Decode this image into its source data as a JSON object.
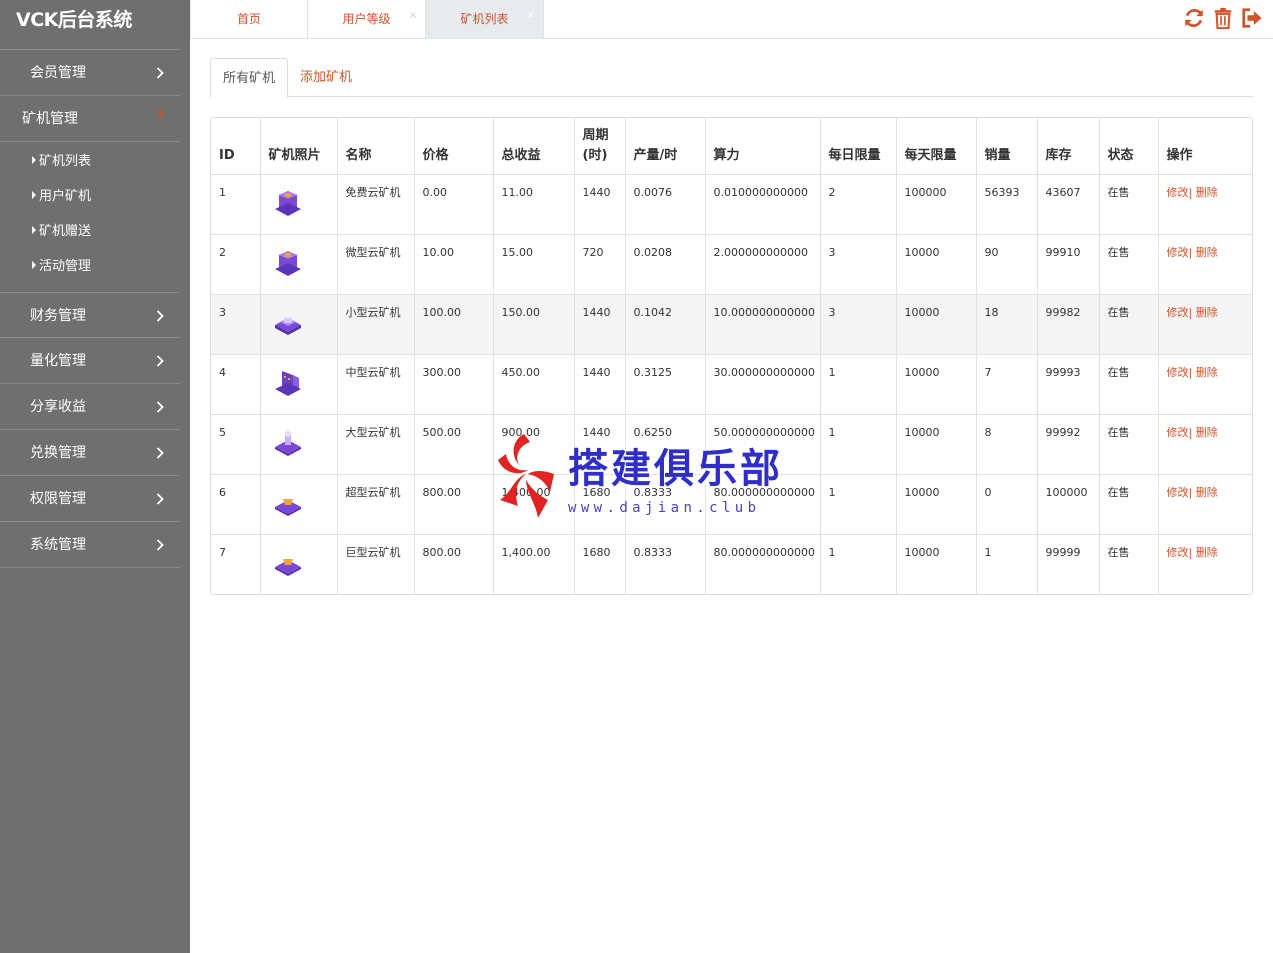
{
  "sidebar": {
    "brand": "VCK后台系统",
    "menu": [
      {
        "label": "会员管理"
      },
      {
        "label": "矿机管理",
        "open": true
      },
      {
        "label": "财务管理"
      },
      {
        "label": "量化管理"
      },
      {
        "label": "分享收益"
      },
      {
        "label": "兑换管理"
      },
      {
        "label": "权限管理"
      },
      {
        "label": "系统管理"
      }
    ],
    "submenu": [
      "矿机列表",
      "用户矿机",
      "矿机赠送",
      "活动管理"
    ]
  },
  "topbar": {
    "tabs": [
      {
        "label": "首页"
      },
      {
        "label": "用户等级"
      },
      {
        "label": "矿机列表",
        "active": true
      }
    ],
    "close_glyph": "×",
    "tools": [
      "refresh-icon",
      "trash-icon",
      "logout-icon"
    ]
  },
  "subtabs": [
    "所有矿机",
    "添加矿机"
  ],
  "table": {
    "headers": [
      "ID",
      "矿机照片",
      "名称",
      "价格",
      "总收益",
      "周期(时)",
      "产量/时",
      "算力",
      "每日限量",
      "每天限量",
      "销量",
      "库存",
      "状态",
      "操作"
    ],
    "header_period_line1": "周期",
    "header_period_line2": "(时)",
    "rows": [
      {
        "id": "1",
        "name": "免费云矿机",
        "price": "0.00",
        "total": "11.00",
        "period": "1440",
        "output": "0.0076",
        "power": "0.010000000000",
        "daily": "2",
        "perday": "100000",
        "sold": "56393",
        "stock": "43607",
        "status": "在售"
      },
      {
        "id": "2",
        "name": "微型云矿机",
        "price": "10.00",
        "total": "15.00",
        "period": "720",
        "output": "0.0208",
        "power": "2.000000000000",
        "daily": "3",
        "perday": "10000",
        "sold": "90",
        "stock": "99910",
        "status": "在售"
      },
      {
        "id": "3",
        "name": "小型云矿机",
        "price": "100.00",
        "total": "150.00",
        "period": "1440",
        "output": "0.1042",
        "power": "10.000000000000",
        "daily": "3",
        "perday": "10000",
        "sold": "18",
        "stock": "99982",
        "status": "在售"
      },
      {
        "id": "4",
        "name": "中型云矿机",
        "price": "300.00",
        "total": "450.00",
        "period": "1440",
        "output": "0.3125",
        "power": "30.000000000000",
        "daily": "1",
        "perday": "10000",
        "sold": "7",
        "stock": "99993",
        "status": "在售"
      },
      {
        "id": "5",
        "name": "大型云矿机",
        "price": "500.00",
        "total": "900.00",
        "period": "1440",
        "output": "0.6250",
        "power": "50.000000000000",
        "daily": "1",
        "perday": "10000",
        "sold": "8",
        "stock": "99992",
        "status": "在售"
      },
      {
        "id": "6",
        "name": "超型云矿机",
        "price": "800.00",
        "total": "1,400.00",
        "period": "1680",
        "output": "0.8333",
        "power": "80.000000000000",
        "daily": "1",
        "perday": "10000",
        "sold": "0",
        "stock": "100000",
        "status": "在售"
      },
      {
        "id": "7",
        "name": "巨型云矿机",
        "price": "800.00",
        "total": "1,400.00",
        "period": "1680",
        "output": "0.8333",
        "power": "80.000000000000",
        "daily": "1",
        "perday": "10000",
        "sold": "1",
        "stock": "99999",
        "status": "在售"
      }
    ],
    "edit_label": "修改",
    "separator": "|",
    "delete_label": "删除"
  },
  "watermark": {
    "text": "搭建俱乐部",
    "url": "www.dajian.club"
  },
  "colors": {
    "sidebar_bg": "#6f6f6f",
    "accent": "#d0532a",
    "photo_purple": "#6a3fc8"
  }
}
